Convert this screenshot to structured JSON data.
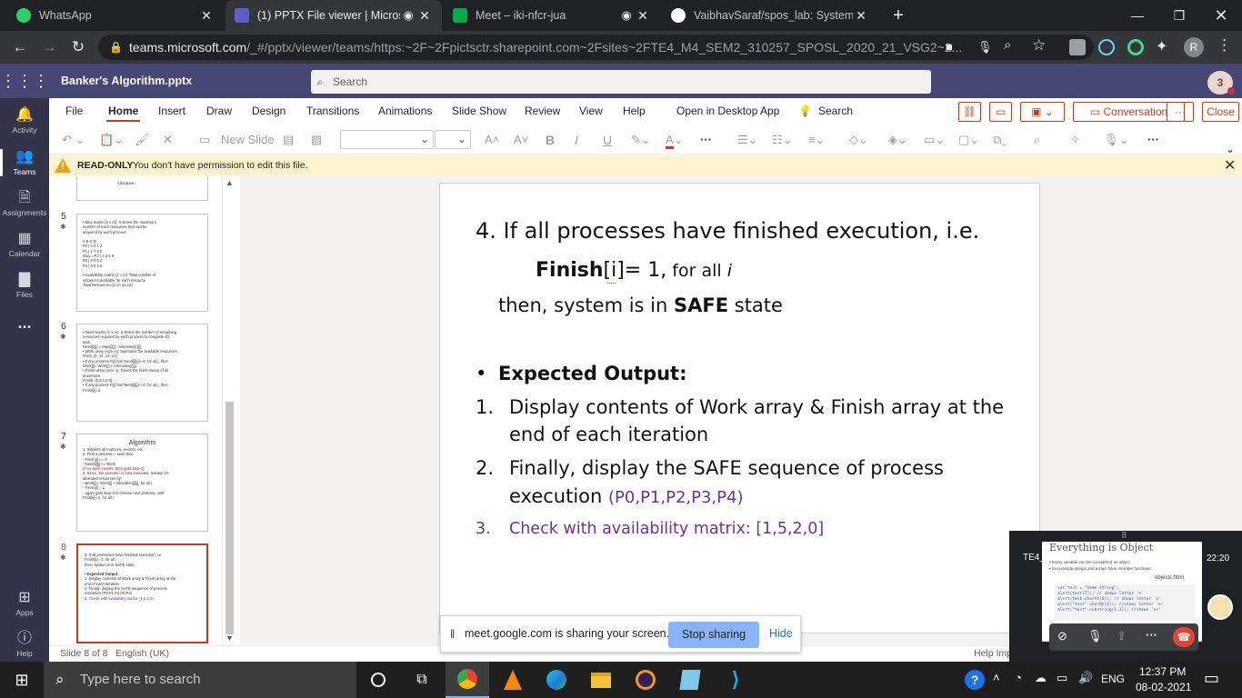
{
  "browser": {
    "tabs": [
      {
        "title": "WhatsApp",
        "icon_color": "#25d366"
      },
      {
        "title": "(1) PPTX File viewer | Microsc",
        "icon_color": "#5b5fc7"
      },
      {
        "title": "Meet – iki-nfcr-jua",
        "icon_color": "#00ac47"
      },
      {
        "title": "VaibhavSaraf/spos_lab: System Pr",
        "icon_color": "#ffffff"
      }
    ],
    "new_tab": "+",
    "url_main": "teams.microsoft.com",
    "url_rest": "/_#/pptx/viewer/teams/https:~2F~2Fpictsctr.sharepoint.com~2Fsites~2FTE4_M4_SEM2_310257_SPOSL_2020_21_VSG2~2...",
    "profile_initial": "R"
  },
  "teams": {
    "doc_title": "Banker's Algorithm.pptx",
    "search_placeholder": "Search",
    "notif_count": "3",
    "rail": [
      {
        "label": "Activity",
        "icon": "bell-icon"
      },
      {
        "label": "Teams",
        "icon": "teams-icon"
      },
      {
        "label": "Assignments",
        "icon": "assignments-icon"
      },
      {
        "label": "Calendar",
        "icon": "calendar-icon"
      },
      {
        "label": "Files",
        "icon": "files-icon"
      },
      {
        "label": "...",
        "icon": "more-icon"
      },
      {
        "label": "Apps",
        "icon": "apps-icon"
      },
      {
        "label": "Help",
        "icon": "help-icon"
      }
    ]
  },
  "ribbon": {
    "tabs": [
      "File",
      "Home",
      "Insert",
      "Draw",
      "Design",
      "Transitions",
      "Animations",
      "Slide Show",
      "Review",
      "View",
      "Help"
    ],
    "active_tab": "Home",
    "open_desktop": "Open in Desktop App",
    "tell_me": "Search",
    "conversation": "Conversation",
    "more": "···",
    "close": "Close",
    "new_slide": "New Slide",
    "accent": "#c43e1c"
  },
  "banner": {
    "label": "READ-ONLY",
    "message": "You don't have permission to edit this file."
  },
  "thumbnails": {
    "slide4_fragment": "Allocation=",
    "slide5": {
      "num": "5",
      "lines": [
        "• Max matrix (n x m): It stores the maximum",
        "  number of each resources that can be",
        "  acquired by each process",
        "",
        "            A B C D",
        "        P0 | 0 0 1 2",
        "        P1 | 1 7 5 0",
        "  Max =  P2 | 2 3 5 6",
        "        P3 | 0 6 5 2",
        "        P4 | 0 6 5 6",
        "",
        "• Availability matrix (1 x m): Total number of",
        "  instances available for each resource",
        "     Total Resources=[3  14  12  12]"
      ]
    },
    "slide6": {
      "num": "6",
      "lines": [
        "• Need matrix (n x m): It stores the number of remaining",
        "  resources required by each process to complete it's",
        "  task.",
        "     Need[i][j] = Max[i][j] - Allocation[i][j]",
        "• Work array (size m): Maintains the available resources.",
        "     Work: [3, 14, 12, 12]",
        "• If any process P[i] has Need[i][j]<=0, for all j, then",
        "     Work[j]= Work[j] + Allocation[i][j]",
        "• Finish array (size n): Stores the finish status of all",
        "  processes.",
        "     Finish: [0,0,0,0,0]",
        "• If any process P[i] has Need[i][j]<=0, for all j, then",
        "     Finish[i]=1"
      ]
    },
    "slide7": {
      "num": "7",
      "title": "Algorithm",
      "lines": [
        "1.  Initialize all matrices, vectors, etc.",
        "2.  Find a process, i, such that:",
        "  -  Finish[i] == 0",
        "  -  Need[i][j] <= Work",
        "     (If no such i exists, then goto step-4)",
        "3.  Since, the process i is now executed, release it's",
        "    allocated resources by:",
        "  -  Work[j]= Work[j] + Allocation[i][j], for all j",
        "  -  Finish[i] = 1",
        "  -  again goto step-3 to choose next process, until",
        "     Finish[i]=1, for all i"
      ]
    },
    "slide8": {
      "num": "8",
      "lines": [
        "4. If all processes have finished execution, i.e.",
        "         Finish[i]= 1, for all i",
        "   then, system is in SAFE state",
        "",
        "• Expected Output:",
        "1.  Display contents of Work array & Finish array at the",
        "    end of each iteration",
        "2.  Finally, display the SAFE sequence of process",
        "    execution (P0,P1,P2,P3,P4)",
        "3.  Check with availability matrix: [1,5,2,0]"
      ]
    }
  },
  "slide": {
    "line1": "4. If all processes have finished execution, i.e.",
    "finish_bold": "Finish",
    "finish_rest": "[i]= 1,",
    "for_all": " for all ",
    "i_italic": "i",
    "then_pre": "then, system is in ",
    "safe": "SAFE",
    "then_post": " state",
    "bullet": "•",
    "expected": "Expected Output:",
    "items": [
      {
        "num": "1.",
        "l1": "Display contents of Work array & Finish array at the",
        "l2": "end of each iteration"
      },
      {
        "num": "2.",
        "l1": "Finally, display the SAFE sequence of process",
        "l2a": "execution ",
        "l2b": "(P0,P1,P2,P3,P4)"
      },
      {
        "num": "3.",
        "l1": "Check with availability matrix: [1,5,2,0]"
      }
    ],
    "purple": "#7030a0"
  },
  "status": {
    "slide_count": "Slide 8 of 8",
    "language": "English (UK)",
    "help": "Help Imp"
  },
  "share": {
    "message": "meet.google.com is sharing your screen.",
    "stop": "Stop sharing",
    "hide": "Hide"
  },
  "meet": {
    "name": "TE4_WT",
    "time": "22:20",
    "heading": "Everything is Object",
    "sub1": "• Every variable can be considered as object",
    "sub2": "• for example strings and arrays have member functions:",
    "file": "objects.html",
    "code": [
      "var test = \"some string\";",
      "alert(test[7]); // shows letter 'e'",
      "alert(test.charAt(5)); // shows letter 's'",
      "alert(\"test\".charAt(1)); //shows letter 'e'",
      "alert(\"test\".substring(1,3)); //shows 'es'"
    ]
  },
  "taskbar": {
    "search": "Type here to search",
    "lang": "ENG",
    "time": "12:37 PM",
    "date": "08-02-2021"
  }
}
